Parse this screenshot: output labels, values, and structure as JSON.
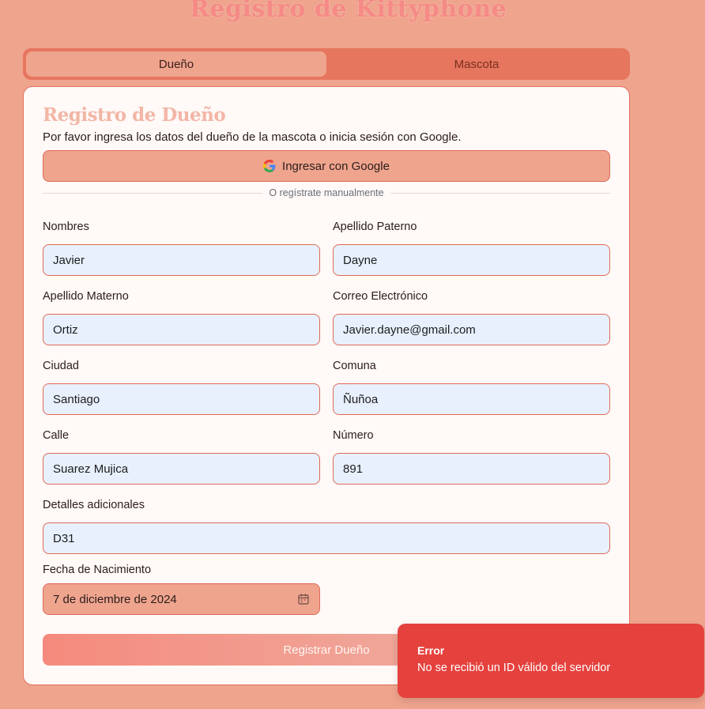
{
  "page": {
    "title": "Registro de Kittyphone"
  },
  "tabs": [
    {
      "label": "Dueño",
      "active": true
    },
    {
      "label": "Mascota",
      "active": false
    }
  ],
  "form": {
    "title": "Registro de Dueño",
    "subtitle": "Por favor ingresa los datos del dueño de la mascota o inicia sesión con Google.",
    "google_button": "Ingresar con Google",
    "divider_text": "O regístrate manualmente",
    "fields": {
      "nombres": {
        "label": "Nombres",
        "value": "Javier"
      },
      "apellido_paterno": {
        "label": "Apellido Paterno",
        "value": "Dayne"
      },
      "apellido_materno": {
        "label": "Apellido Materno",
        "value": "Ortiz"
      },
      "correo": {
        "label": "Correo Electrónico",
        "value": "Javier.dayne@gmail.com"
      },
      "ciudad": {
        "label": "Ciudad",
        "value": "Santiago"
      },
      "comuna": {
        "label": "Comuna",
        "value": "Ñuñoa"
      },
      "calle": {
        "label": "Calle",
        "value": "Suarez Mujica"
      },
      "numero": {
        "label": "Número",
        "value": "891"
      },
      "detalles": {
        "label": "Detalles adicionales",
        "value": "D31"
      },
      "fecha_nacimiento": {
        "label": "Fecha de Nacimiento",
        "value": "7 de diciembre de 2024"
      }
    },
    "submit_button": "Registrar Dueño"
  },
  "toast": {
    "title": "Error",
    "message": "No se recibió un ID válido del servidor"
  },
  "colors": {
    "background": "#efa48e",
    "accent": "#e6765e",
    "input_bg": "#e8f0fe",
    "error": "#e5413d"
  }
}
